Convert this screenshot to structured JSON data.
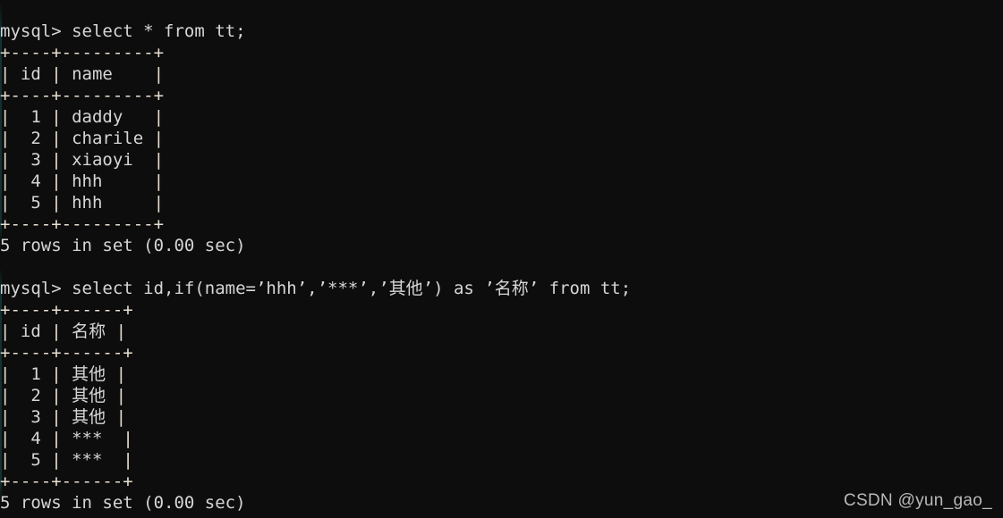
{
  "terminal": {
    "background_color": "#0d0d0d",
    "text_color": "#d6d6d6",
    "border_color": "#e8dfd2",
    "lines": [
      "mysql> select * from tt;",
      "+----+---------+",
      "| id | name    |",
      "+----+---------+",
      "|  1 | daddy   |",
      "|  2 | charile |",
      "|  3 | xiaoyi  |",
      "|  4 | hhh     |",
      "|  5 | hhh     |",
      "+----+---------+",
      "5 rows in set (0.00 sec)",
      "",
      "mysql> select id,if(name=’hhh’,’***’,’其他’) as ’名称’ from tt;",
      "+----+------+",
      "| id | 名称 |",
      "+----+------+",
      "|  1 | 其他 |",
      "|  2 | 其他 |",
      "|  3 | 其他 |",
      "|  4 | ***  |",
      "|  5 | ***  |",
      "+----+------+",
      "5 rows in set (0.00 sec)"
    ],
    "query_1": {
      "prompt": "mysql>",
      "sql": "select * from tt;",
      "result_status": "5 rows in set (0.00 sec)",
      "table": {
        "columns": [
          "id",
          "name"
        ],
        "rows": [
          [
            "1",
            "daddy"
          ],
          [
            "2",
            "charile"
          ],
          [
            "3",
            "xiaoyi"
          ],
          [
            "4",
            "hhh"
          ],
          [
            "5",
            "hhh"
          ]
        ]
      }
    },
    "query_2": {
      "prompt": "mysql>",
      "sql": "select id,if(name=’hhh’,’***’,’其他’) as ’名称’ from tt;",
      "result_status": "5 rows in set (0.00 sec)",
      "table": {
        "columns": [
          "id",
          "名称"
        ],
        "rows": [
          [
            "1",
            "其他"
          ],
          [
            "2",
            "其他"
          ],
          [
            "3",
            "其他"
          ],
          [
            "4",
            "***"
          ],
          [
            "5",
            "***"
          ]
        ]
      }
    }
  },
  "watermark": {
    "text": "CSDN @yun_gao_"
  }
}
